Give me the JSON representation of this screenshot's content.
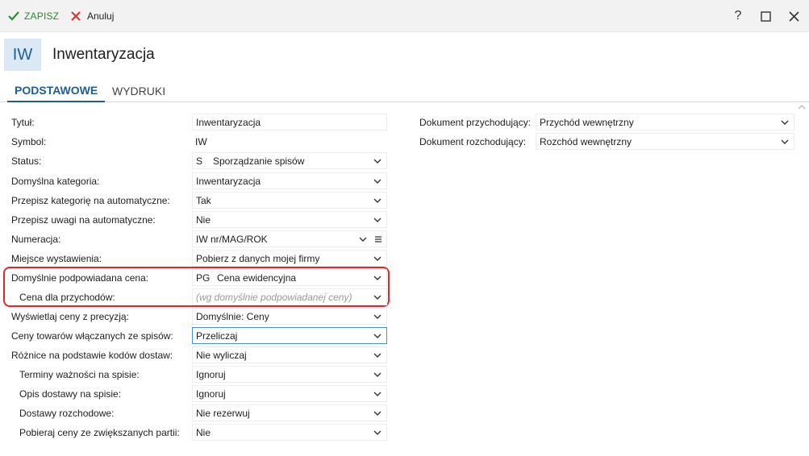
{
  "toolbar": {
    "save_label": "ZAPISZ",
    "cancel_label": "Anuluj",
    "help_label": "?"
  },
  "header": {
    "badge": "IW",
    "title": "Inwentaryzacja"
  },
  "tabs": [
    {
      "label": "PODSTAWOWE"
    },
    {
      "label": "WYDRUKI"
    }
  ],
  "left": {
    "tytul_label": "Tytuł:",
    "tytul_value": "Inwentaryzacja",
    "symbol_label": "Symbol:",
    "symbol_value": "IW",
    "status_label": "Status:",
    "status_code": "S",
    "status_value": "Sporządzanie spisów",
    "kategoria_label": "Domyślna kategoria:",
    "kategoria_value": "Inwentaryzacja",
    "przepisz_kat_label": "Przepisz kategorię na automatyczne:",
    "przepisz_kat_value": "Tak",
    "przepisz_uwagi_label": "Przepisz uwagi na automatyczne:",
    "przepisz_uwagi_value": "Nie",
    "numeracja_label": "Numeracja:",
    "numeracja_value": "IW nr/MAG/ROK",
    "miejsce_label": "Miejsce wystawienia:",
    "miejsce_value": "Pobierz z danych mojej firmy",
    "cena_label": "Domyślnie podpowiadana cena:",
    "cena_code": "PG",
    "cena_value": "Cena ewidencyjna",
    "cena_przych_label": "Cena dla przychodów:",
    "cena_przych_placeholder": "(wg domyślnie podpowiadanej ceny)",
    "precyzja_label": "Wyświetlaj ceny z precyzją:",
    "precyzja_value": "Domyślnie: Ceny",
    "ceny_towarow_label": "Ceny towarów włączanych ze spisów:",
    "ceny_towarow_value": "Przeliczaj",
    "roznice_label": "Różnice na podstawie kodów dostaw:",
    "roznice_value": "Nie wyliczaj",
    "terminy_label": "Terminy ważności na spisie:",
    "terminy_value": "Ignoruj",
    "opis_label": "Opis dostawy na spisie:",
    "opis_value": "Ignoruj",
    "dostawy_label": "Dostawy rozchodowe:",
    "dostawy_value": "Nie rezerwuj",
    "pobieraj_label": "Pobieraj ceny ze zwiększanych partii:",
    "pobieraj_value": "Nie"
  },
  "right": {
    "przych_label": "Dokument przychodujący:",
    "przych_value": "Przychód wewnętrzny",
    "rozch_label": "Dokument rozchodujący:",
    "rozch_value": "Rozchód wewnętrzny"
  },
  "colors": {
    "save_green": "#2e8b2e",
    "cancel_red": "#d9302c",
    "accent_blue": "#1f5d95",
    "badge_bg": "#dbe9f6",
    "highlight_red": "#e0262e"
  }
}
